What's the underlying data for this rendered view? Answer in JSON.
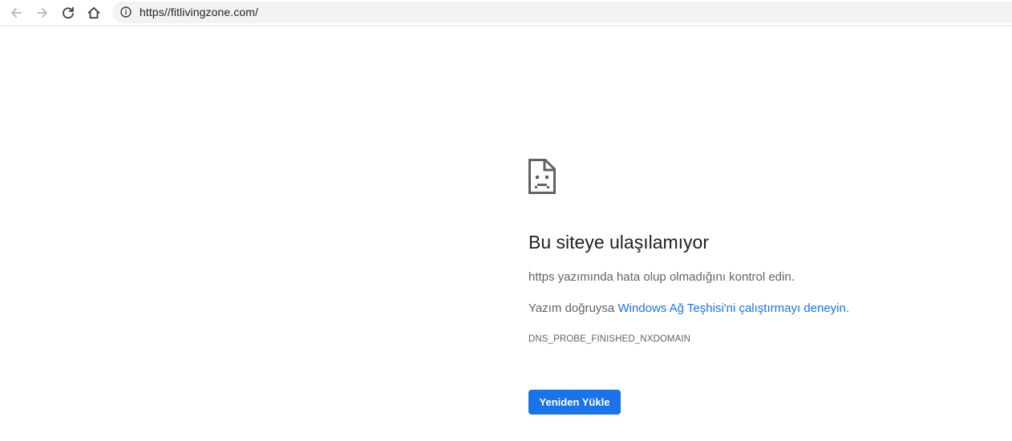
{
  "browser": {
    "url": "https//fitlivingzone.com/",
    "icons": {
      "back": "arrow-left-icon",
      "forward": "arrow-right-icon",
      "reload": "reload-icon",
      "home": "home-icon",
      "info": "info-icon"
    }
  },
  "error": {
    "icon": "sad-document-icon",
    "title": "Bu siteye ulaşılamıyor",
    "line1": "https yazımında hata olup olmadığını kontrol edin.",
    "line2_prefix": "Yazım doğruysa ",
    "line2_link": "Windows Ağ Teşhisi'ni çalıştırmayı deneyin",
    "line2_suffix": ".",
    "code": "DNS_PROBE_FINISHED_NXDOMAIN",
    "reload_label": "Yeniden Yükle"
  },
  "colors": {
    "accent": "#1a73e8",
    "text": "#202124",
    "muted": "#5f6368",
    "omnibox_bg": "#f1f3f4"
  }
}
